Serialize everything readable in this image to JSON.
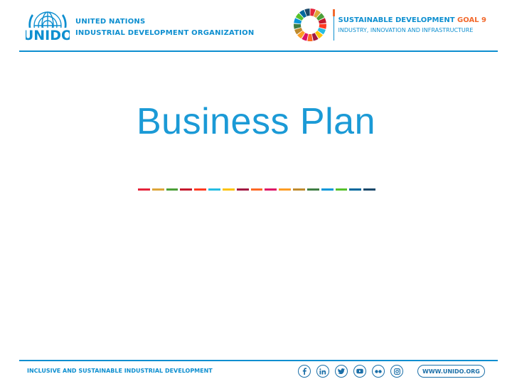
{
  "header": {
    "org_logo_lettering": "UNIDO",
    "org_line1": "UNITED NATIONS",
    "org_line2": "INDUSTRIAL DEVELOPMENT ORGANIZATION",
    "sdg_title_main": "SUSTAINABLE DEVELOPMENT ",
    "sdg_title_goal": "GOAL 9",
    "sdg_subtitle": "INDUSTRY, INNOVATION AND INFRASTRUCTURE"
  },
  "slide": {
    "title": "Business Plan"
  },
  "footer": {
    "tagline": "INCLUSIVE AND SUSTAINABLE INDUSTRIAL DEVELOPMENT",
    "url": "WWW.UNIDO.ORG",
    "social_icons": [
      "facebook-icon",
      "linkedin-icon",
      "twitter-icon",
      "youtube-icon",
      "flickr-icon",
      "instagram-icon"
    ]
  },
  "colors": {
    "brand_blue": "#0e8fd0",
    "title_blue": "#1b9ad6",
    "goal_orange": "#f26a2e",
    "sdg_palette": [
      "#e5243b",
      "#dda63a",
      "#4c9f38",
      "#c5192d",
      "#ff3a21",
      "#26bde2",
      "#fcc30b",
      "#a21942",
      "#fd6925",
      "#dd1367",
      "#fd9d24",
      "#bf8b2e",
      "#3f7e44",
      "#0a97d9",
      "#56c02b",
      "#00689d",
      "#19486a"
    ]
  }
}
